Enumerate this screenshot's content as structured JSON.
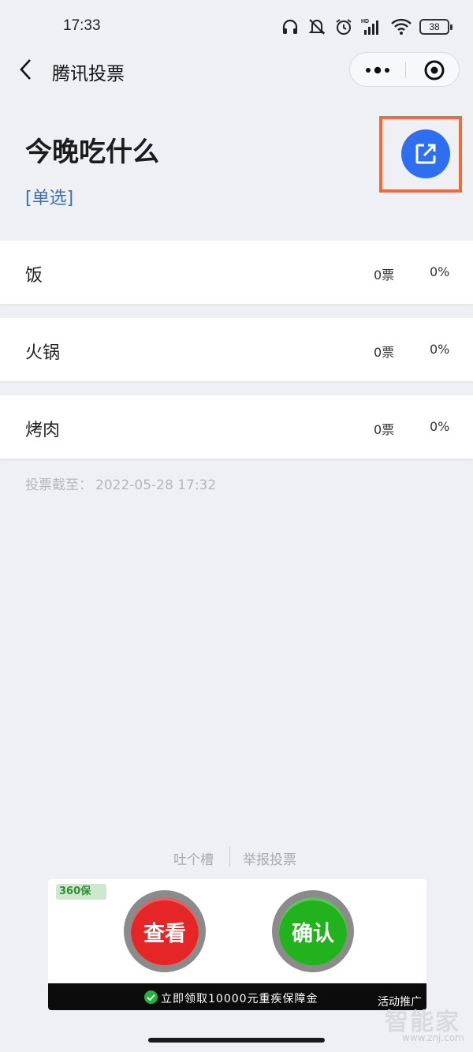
{
  "status_bar": {
    "time": "17:33",
    "battery": "38",
    "icons": [
      "headphones-icon",
      "mute-icon",
      "alarm-icon",
      "hd-signal-icon",
      "wifi-icon",
      "battery-icon"
    ]
  },
  "nav": {
    "title": "腾讯投票",
    "back_icon": "chevron-left-icon",
    "more_icon": "more-dots-icon",
    "close_icon": "target-circle-icon"
  },
  "vote": {
    "title": "今晚吃什么",
    "type": "[单选]",
    "share_icon": "external-link-icon",
    "accent_color": "#2e6ef0",
    "highlight_color": "#f26a3a"
  },
  "options": [
    {
      "label": "饭",
      "votes": "0票",
      "percent": "0%"
    },
    {
      "label": "火锅",
      "votes": "0票",
      "percent": "0%"
    },
    {
      "label": "烤肉",
      "votes": "0票",
      "percent": "0%"
    }
  ],
  "deadline": {
    "label": "投票截至：",
    "value": "2022-05-28 17:32"
  },
  "footer": {
    "complain": "吐个槽",
    "report": "举报投票"
  },
  "ad": {
    "logo": "360保",
    "btn_view": "查看",
    "btn_confirm": "确认",
    "banner_text": "立即领取10000元重疾保障金",
    "tag": "活动推广"
  },
  "watermark": {
    "main": "智能家",
    "sub": "www.znj.com"
  }
}
